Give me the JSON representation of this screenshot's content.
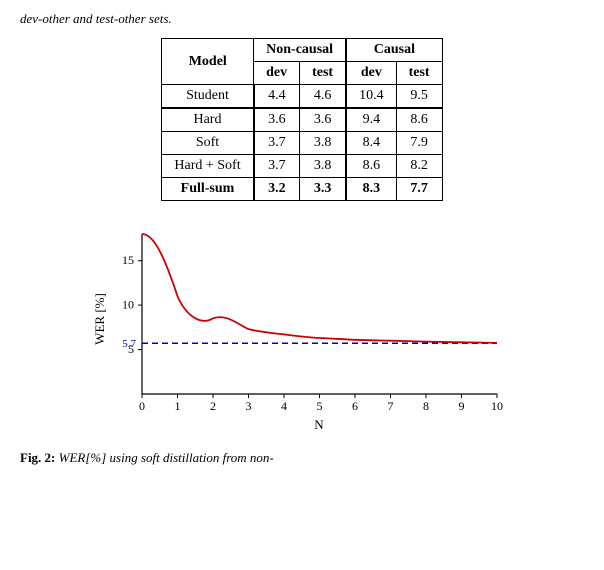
{
  "intro": {
    "text": "dev-other and test-other sets."
  },
  "table": {
    "col_groups": [
      "Non-causal",
      "Causal"
    ],
    "sub_cols": [
      "dev",
      "test",
      "dev",
      "test"
    ],
    "model_col": "Model",
    "rows": [
      {
        "model": "Student",
        "vals": [
          "4.4",
          "4.6",
          "10.4",
          "9.5"
        ],
        "bold": false,
        "group_sep": false
      },
      {
        "model": "Hard",
        "vals": [
          "3.6",
          "3.6",
          "9.4",
          "8.6"
        ],
        "bold": false,
        "group_sep": true
      },
      {
        "model": "Soft",
        "vals": [
          "3.7",
          "3.8",
          "8.4",
          "7.9"
        ],
        "bold": false,
        "group_sep": false
      },
      {
        "model": "Hard + Soft",
        "vals": [
          "3.7",
          "3.8",
          "8.6",
          "8.2"
        ],
        "bold": false,
        "group_sep": false
      },
      {
        "model": "Full-sum",
        "vals": [
          "3.2",
          "3.3",
          "8.3",
          "7.7"
        ],
        "bold": true,
        "group_sep": false
      }
    ]
  },
  "chart": {
    "y_label": "WER [%]",
    "x_label": "N",
    "x_ticks": [
      "0",
      "1",
      "2",
      "3",
      "4",
      "5",
      "6",
      "7",
      "8",
      "9",
      "10"
    ],
    "y_ticks": [
      "5",
      "10",
      "15"
    ],
    "dashed_value": 5.7,
    "dashed_label": "5.7",
    "curve_color": "#cc0000",
    "dashed_color": "#0000cc"
  },
  "caption": {
    "fig_label": "Fig. 2:",
    "text": " WER[%] using soft distillation from non-"
  }
}
